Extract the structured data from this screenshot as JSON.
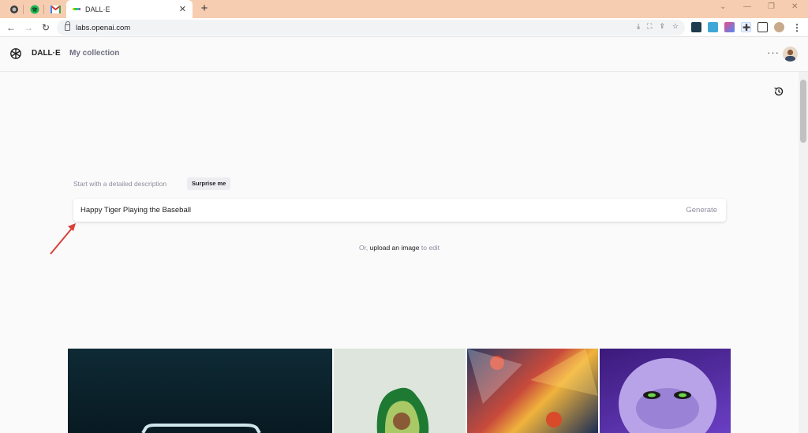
{
  "browser": {
    "tab_title": "DALL·E",
    "url": "labs.openai.com"
  },
  "header": {
    "brand": "DALL·E",
    "collection_link": "My collection",
    "more": "···"
  },
  "prompt": {
    "hint": "Start with a detailed description",
    "surprise_button": "Surprise me",
    "value": "Happy Tiger Playing the Baseball",
    "generate_button": "Generate"
  },
  "upload": {
    "prefix": "Or,",
    "link": "upload an image",
    "suffix": "to edit"
  },
  "colors": {
    "tabbar": "#f6cdb0",
    "background": "#fafafa",
    "annotation_arrow": "#d9403a"
  }
}
